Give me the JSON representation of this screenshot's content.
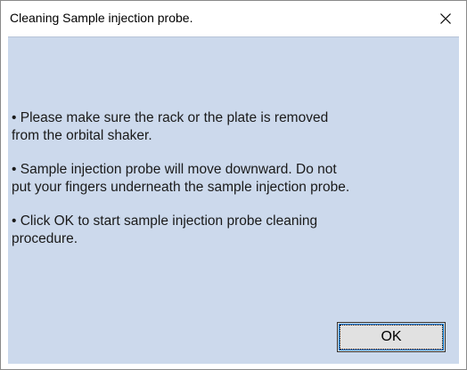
{
  "window": {
    "title": "Cleaning Sample injection probe.",
    "close_icon": "close-icon"
  },
  "messages": [
    {
      "lines": [
        "•  Please make sure the rack or the plate is removed",
        "from the orbital shaker."
      ]
    },
    {
      "lines": [
        "•  Sample injection probe will move downward. Do not",
        "put your fingers underneath the sample injection probe."
      ]
    },
    {
      "lines": [
        "•  Click OK to start sample injection probe cleaning",
        "procedure."
      ]
    }
  ],
  "buttons": {
    "ok_label": "OK"
  },
  "colors": {
    "client_background": "#ccd9ec",
    "button_focus_border": "#0078d7"
  }
}
